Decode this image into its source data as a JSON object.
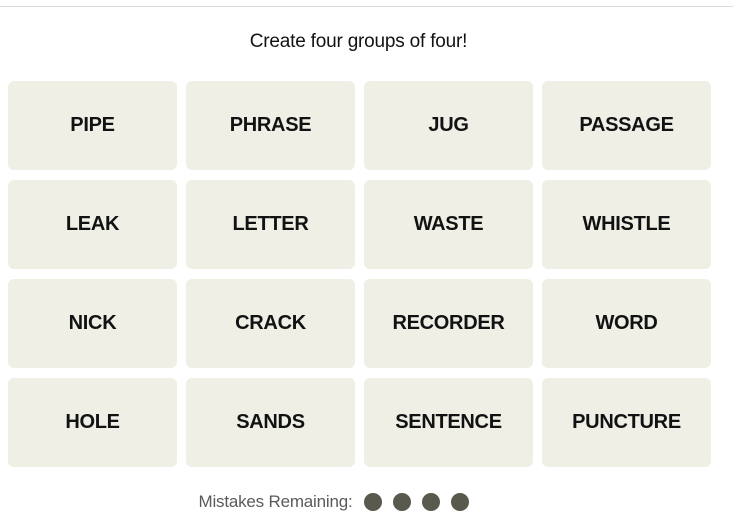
{
  "header": {
    "subtitle": "Create four groups of four!"
  },
  "board": {
    "tiles": [
      "PIPE",
      "PHRASE",
      "JUG",
      "PASSAGE",
      "LEAK",
      "LETTER",
      "WASTE",
      "WHISTLE",
      "NICK",
      "CRACK",
      "RECORDER",
      "WORD",
      "HOLE",
      "SANDS",
      "SENTENCE",
      "PUNCTURE"
    ]
  },
  "status": {
    "mistakes_label": "Mistakes Remaining:",
    "mistakes_remaining": 4,
    "dot_color": "#5a594e"
  },
  "colors": {
    "tile_background": "#efefe6",
    "tile_text": "#121212"
  }
}
